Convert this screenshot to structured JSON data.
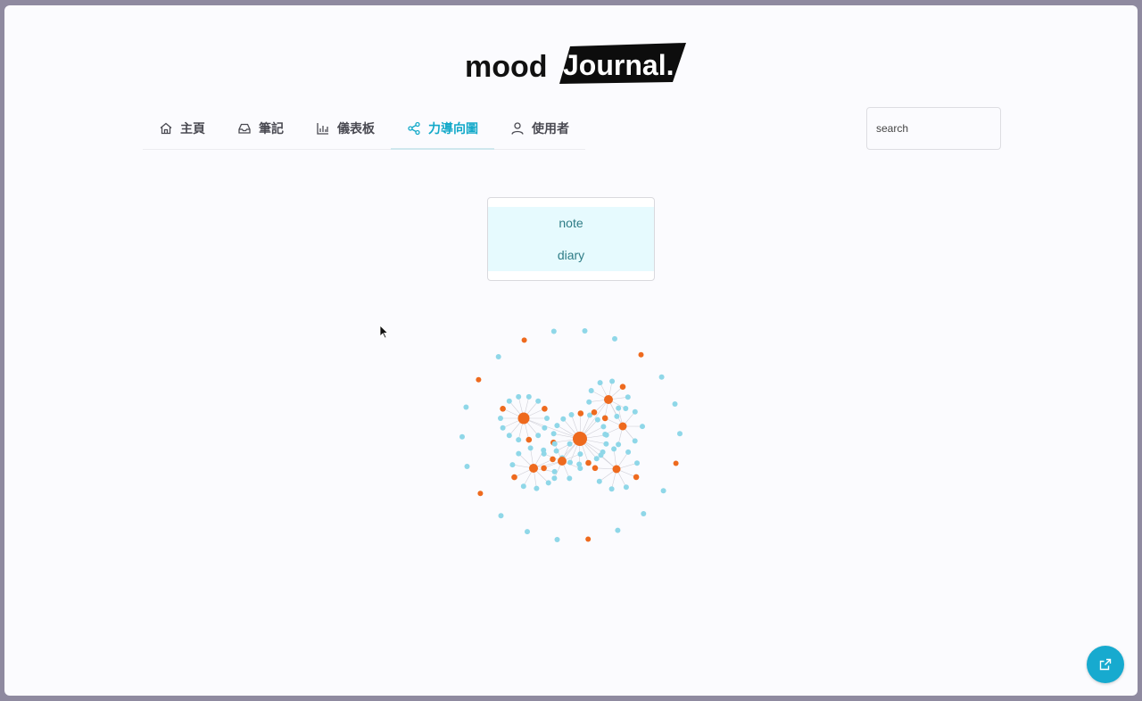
{
  "brand": {
    "logo_text_dark": "mood",
    "logo_text_light": "Journal."
  },
  "nav": {
    "items": [
      {
        "label": "主頁",
        "icon": "home-icon"
      },
      {
        "label": "筆記",
        "icon": "inbox-icon"
      },
      {
        "label": "儀表板",
        "icon": "bar-chart-icon"
      },
      {
        "label": "力導向圖",
        "icon": "share-graph-icon"
      },
      {
        "label": "使用者",
        "icon": "user-icon"
      }
    ],
    "active_index": 3
  },
  "search": {
    "placeholder": "search",
    "value": ""
  },
  "filter": {
    "options": [
      "note",
      "diary"
    ]
  },
  "colors": {
    "accent": "#13a9c9",
    "node_note": "#8fd7e8",
    "node_diary": "#ee6a1e",
    "link": "#d0d0d8"
  },
  "fab": {
    "icon": "external-link-icon"
  }
}
